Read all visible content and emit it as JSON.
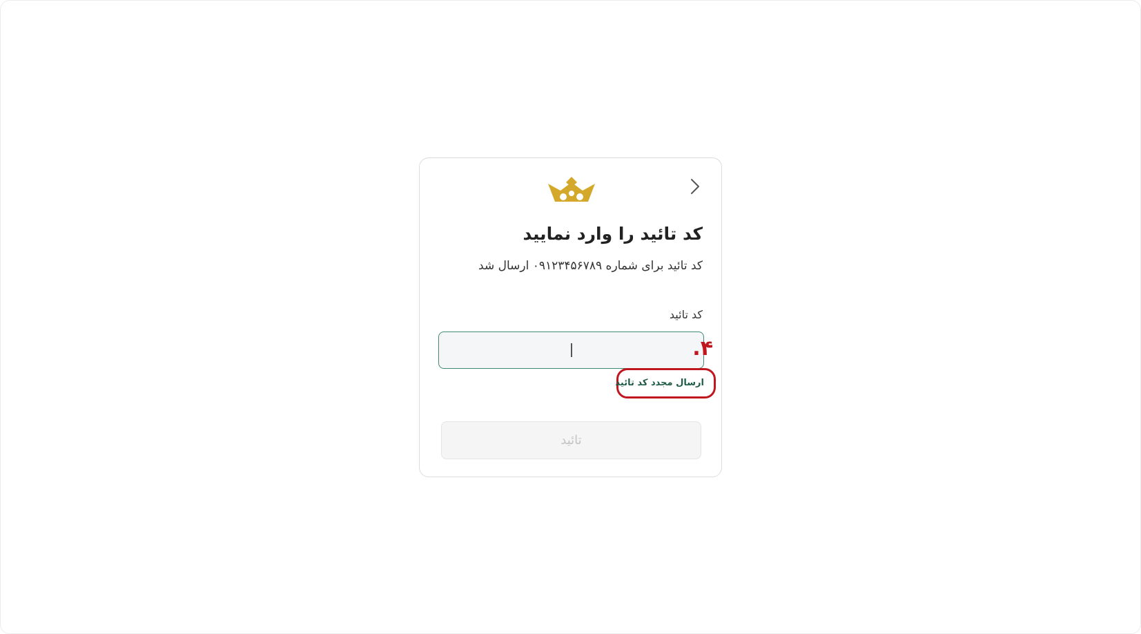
{
  "header": {
    "back_icon": "chevron-right-icon",
    "logo_icon": "crown-icon",
    "logo_color": "#d4a82a"
  },
  "verify": {
    "title": "کد تائید را وارد نمایید",
    "subtitle": "کد تائید برای شماره ۰۹۱۲۳۴۵۶۷۸۹ ارسال شد",
    "code_label": "کد تائید",
    "code_value": "",
    "code_placeholder": "",
    "resend_label": "ارسال مجدد کد تائید",
    "confirm_label": "تائید"
  },
  "annotation": {
    "step_marker": "۴."
  },
  "colors": {
    "accent_green": "#1f5c45",
    "input_border": "#3f8a72",
    "highlight_red": "#c0161e",
    "disabled_text": "#c4c4c4"
  }
}
